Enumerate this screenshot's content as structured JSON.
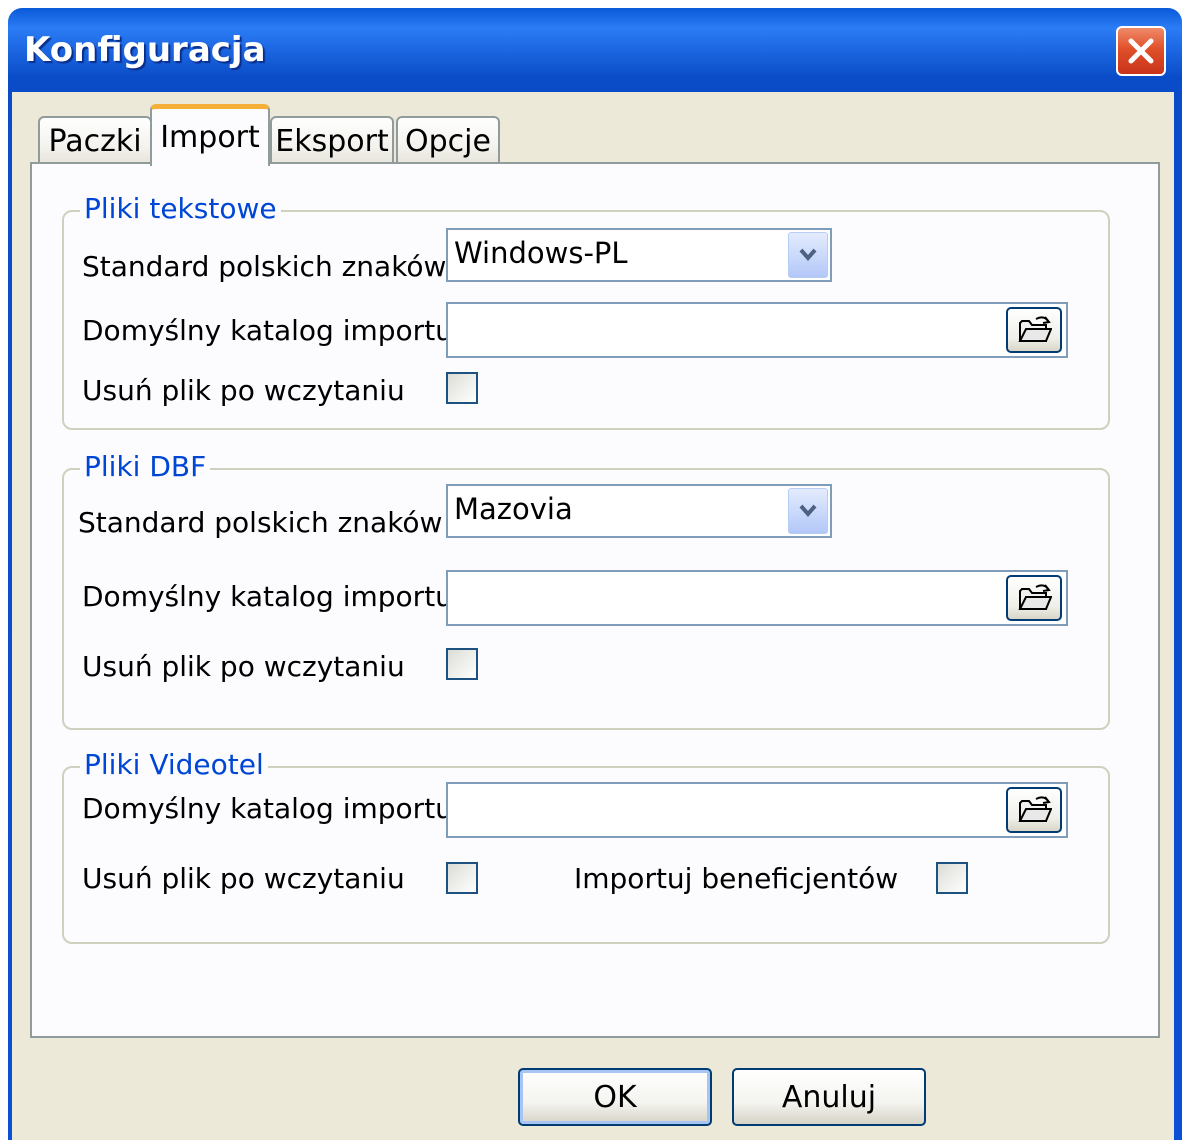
{
  "window": {
    "title": "Konfiguracja"
  },
  "tabs": [
    {
      "label": "Paczki",
      "active": false
    },
    {
      "label": "Import",
      "active": true
    },
    {
      "label": "Eksport",
      "active": false
    },
    {
      "label": "Opcje",
      "active": false
    }
  ],
  "groups": {
    "text_files": {
      "legend": "Pliki tekstowe",
      "charset_label": "Standard polskich znaków",
      "charset_value": "Windows-PL",
      "dir_label": "Domyślny katalog importu",
      "dir_value": "",
      "delete_label": "Usuń plik po wczytaniu",
      "delete_checked": false
    },
    "dbf_files": {
      "legend": "Pliki DBF",
      "charset_label": "Standard polskich znaków",
      "charset_value": "Mazovia",
      "dir_label": "Domyślny katalog importu",
      "dir_value": "",
      "delete_label": "Usuń plik po wczytaniu",
      "delete_checked": false
    },
    "videotel_files": {
      "legend": "Pliki Videotel",
      "dir_label": "Domyślny katalog importu",
      "dir_value": "",
      "delete_label": "Usuń plik po wczytaniu",
      "delete_checked": false,
      "beneficiaries_label": "Importuj beneficjentów",
      "beneficiaries_checked": false
    }
  },
  "buttons": {
    "ok": "OK",
    "cancel": "Anuluj"
  },
  "icons": {
    "close": "close-icon",
    "dropdown": "chevron-down-icon",
    "browse": "folder-open-icon"
  },
  "colors": {
    "titlebar": "#0b4fd4",
    "legend_text": "#0046d5",
    "dialog_bg": "#ece9d8",
    "active_tab_accent": "#f6b03a"
  }
}
